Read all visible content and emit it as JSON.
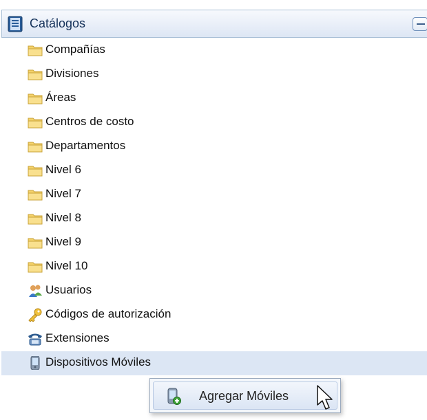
{
  "panel": {
    "title": "Catálogos",
    "icon": "book-icon",
    "collapse_icon": "collapse-minus-icon"
  },
  "tree": {
    "items": [
      {
        "label": "Compañías",
        "icon": "folder-icon"
      },
      {
        "label": "Divisiones",
        "icon": "folder-icon"
      },
      {
        "label": "Áreas",
        "icon": "folder-icon"
      },
      {
        "label": "Centros de costo",
        "icon": "folder-icon"
      },
      {
        "label": "Departamentos",
        "icon": "folder-icon"
      },
      {
        "label": "Nivel 6",
        "icon": "folder-icon"
      },
      {
        "label": "Nivel 7",
        "icon": "folder-icon"
      },
      {
        "label": "Nivel 8",
        "icon": "folder-icon"
      },
      {
        "label": "Nivel 9",
        "icon": "folder-icon"
      },
      {
        "label": "Nivel 10",
        "icon": "folder-icon"
      },
      {
        "label": "Usuarios",
        "icon": "users-icon"
      },
      {
        "label": "Códigos de autorización",
        "icon": "key-icon"
      },
      {
        "label": "Extensiones",
        "icon": "phone-icon"
      },
      {
        "label": "Dispositivos Móviles",
        "icon": "mobile-device-icon",
        "selected": true
      }
    ]
  },
  "context_menu": {
    "items": [
      {
        "label": "Agregar Móviles",
        "icon": "add-mobile-icon"
      }
    ]
  },
  "colors": {
    "header_gradient_top": "#f7f9fd",
    "header_gradient_bottom": "#dde6f4",
    "selected_row": "#dce6f4",
    "border": "#a9bfd6"
  }
}
